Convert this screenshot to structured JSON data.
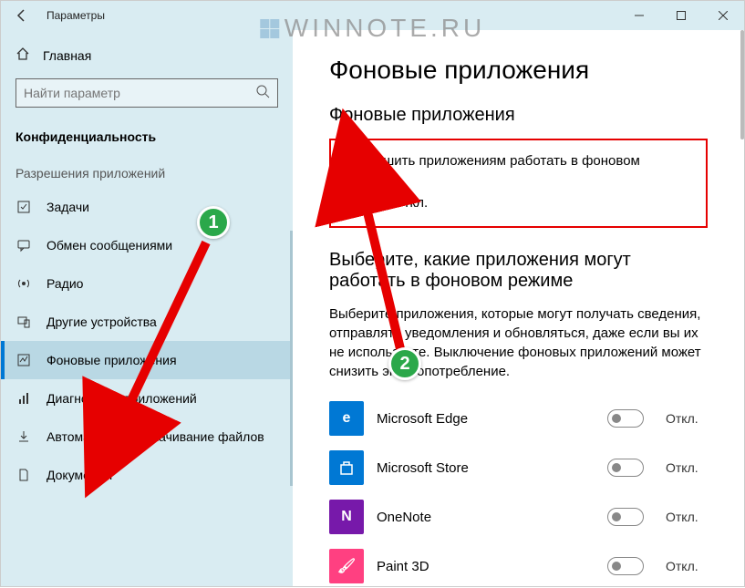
{
  "window": {
    "title": "Параметры"
  },
  "watermark": "WINNOTE.RU",
  "sidebar": {
    "home": "Главная",
    "search_placeholder": "Найти параметр",
    "section": "Конфиденциальность",
    "group_title": "Разрешения приложений",
    "items": [
      {
        "label": "Задачи"
      },
      {
        "label": "Обмен сообщениями"
      },
      {
        "label": "Радио"
      },
      {
        "label": "Другие устройства"
      },
      {
        "label": "Фоновые приложения"
      },
      {
        "label": "Диагностика приложений"
      },
      {
        "label": "Автоматическое скачивание файлов"
      },
      {
        "label": "Документы"
      }
    ]
  },
  "main": {
    "title": "Фоновые приложения",
    "section1_title": "Фоновые приложения",
    "allow_label": "Разрешить приложениям работать в фоновом режиме",
    "allow_state": "Откл.",
    "section2_title": "Выберите, какие приложения могут работать в фоновом режиме",
    "section2_desc": "Выберите приложения, которые могут получать сведения, отправлять уведомления и обновляться, даже если вы их не используете. Выключение фоновых приложений может снизить энергопотребление.",
    "apps": [
      {
        "name": "Microsoft Edge",
        "state": "Откл.",
        "color": "#0078d4",
        "glyph": "e"
      },
      {
        "name": "Microsoft Store",
        "state": "Откл.",
        "color": "#0078d4",
        "glyph": "⬛"
      },
      {
        "name": "OneNote",
        "state": "Откл.",
        "color": "#7719aa",
        "glyph": "N"
      },
      {
        "name": "Paint 3D",
        "state": "Откл.",
        "color": "#ff4081",
        "glyph": "🖌"
      }
    ]
  },
  "annotations": {
    "badge1": "1",
    "badge2": "2"
  }
}
